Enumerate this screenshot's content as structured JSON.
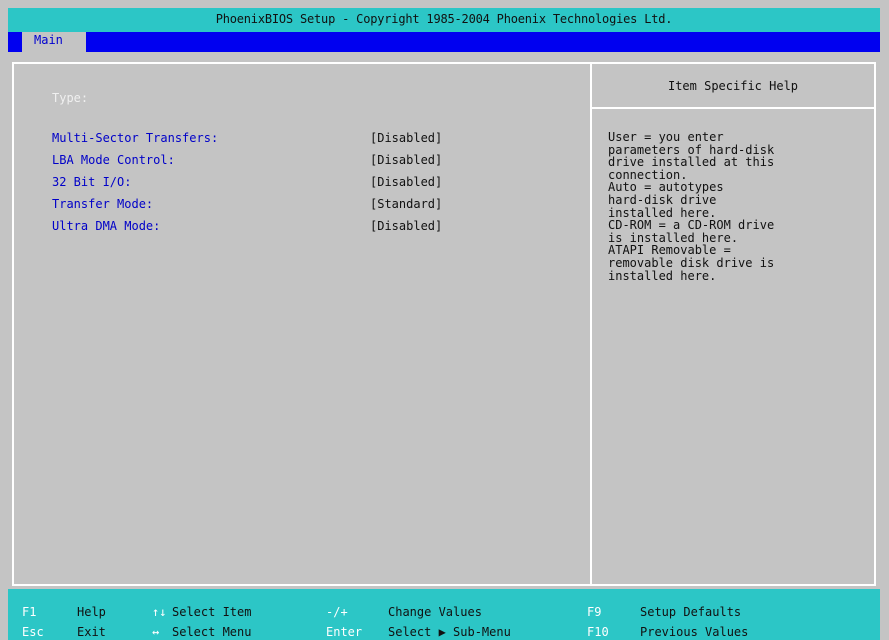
{
  "window": {
    "title": "PhoenixBIOS Setup - Copyright 1985-2004 Phoenix Technologies Ltd."
  },
  "menu": {
    "tabs": [
      {
        "label": "Main",
        "selected": true
      }
    ]
  },
  "main": {
    "type_label": "Type:",
    "settings": [
      {
        "label": "Multi-Sector Transfers:",
        "value": "[Disabled]"
      },
      {
        "label": "LBA Mode Control:",
        "value": "[Disabled]"
      },
      {
        "label": "32 Bit I/O:",
        "value": "[Disabled]"
      },
      {
        "label": "Transfer Mode:",
        "value": "[Standard]"
      },
      {
        "label": "Ultra DMA Mode:",
        "value": "[Disabled]"
      }
    ]
  },
  "help": {
    "title": "Item Specific Help",
    "lines": [
      "User = you enter",
      "parameters of hard-disk",
      "drive installed at this",
      "connection.",
      "Auto = autotypes",
      "hard-disk drive",
      "installed here.",
      "CD-ROM = a CD-ROM drive",
      "is installed here.",
      "ATAPI Removable =",
      "removable disk drive is",
      "installed here."
    ]
  },
  "footer": {
    "row1": [
      {
        "key": "F1",
        "desc": "Help"
      },
      {
        "key": "↑↓",
        "desc": "Select Item"
      },
      {
        "key": "-/+",
        "desc": "Change Values"
      },
      {
        "key": "F9",
        "desc": "Setup Defaults"
      }
    ],
    "row2": [
      {
        "key": "Esc",
        "desc": "Exit"
      },
      {
        "key": "↔",
        "desc": "Select Menu"
      },
      {
        "key": "Enter",
        "desc": "Select ▶ Sub-Menu"
      },
      {
        "key": "F10",
        "desc": "Previous Values"
      }
    ]
  },
  "colors": {
    "title_bar": "#2cc6c6",
    "menu_bar": "#0000f0",
    "panel_bg": "#c4c4c4",
    "label_blue": "#0000c8",
    "frame": "#ffffff"
  }
}
